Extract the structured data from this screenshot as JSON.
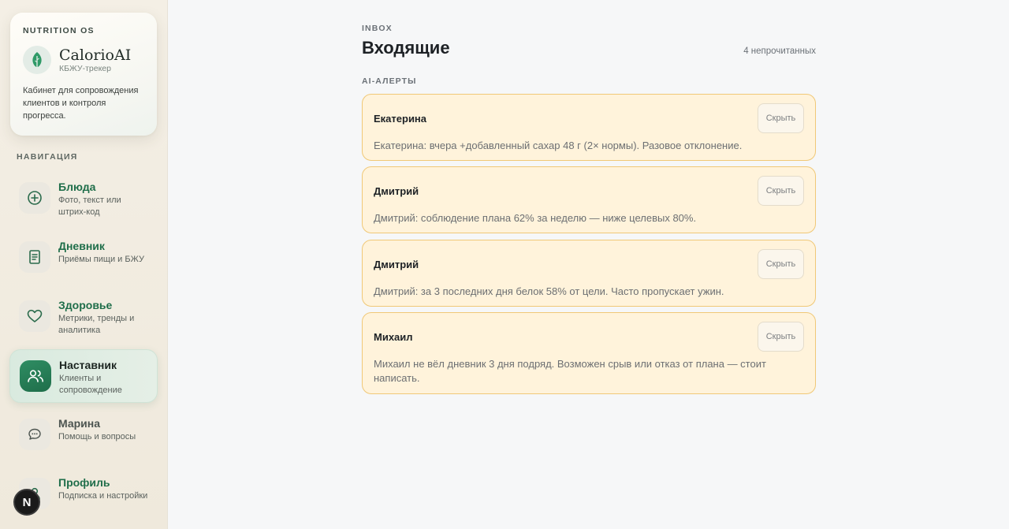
{
  "brand": {
    "kicker": "NUTRITION OS",
    "name": "CalorioAI",
    "subtitle": "КБЖУ-трекер",
    "description": "Кабинет для сопровождения клиентов и контроля прогресса."
  },
  "nav": {
    "title": "НАВИГАЦИЯ",
    "items": [
      {
        "label": "Блюда",
        "desc": "Фото, текст или штрих-код",
        "icon": "plus-circle-icon"
      },
      {
        "label": "Дневник",
        "desc": "Приёмы пищи и БЖУ",
        "icon": "journal-icon"
      },
      {
        "label": "Здоровье",
        "desc": "Метрики, тренды и аналитика",
        "icon": "heart-icon"
      },
      {
        "label": "Наставник",
        "desc": "Клиенты и сопровождение",
        "icon": "users-icon",
        "active": true
      },
      {
        "label": "Марина",
        "desc": "Помощь и вопросы",
        "icon": "chat-icon"
      },
      {
        "label": "Профиль",
        "desc": "Подписка и настройки",
        "icon": "user-icon"
      }
    ]
  },
  "badge": {
    "letter": "N"
  },
  "inbox": {
    "kicker": "INBOX",
    "title": "Входящие",
    "unread": "4 непрочитанных",
    "section": "AI-АЛЕРТЫ",
    "hide_label": "Скрыть",
    "alerts": [
      {
        "name": "Екатерина",
        "text": "Екатерина: вчера +добавленный сахар 48 г (2× нормы). Разовое отклонение."
      },
      {
        "name": "Дмитрий",
        "text": "Дмитрий: соблюдение плана 62% за неделю — ниже целевых 80%."
      },
      {
        "name": "Дмитрий",
        "text": "Дмитрий: за 3 последних дня белок 58% от цели. Часто пропускает ужин."
      },
      {
        "name": "Михаил",
        "text": "Михаил не вёл дневник 3 дня подряд. Возможен срыв или отказ от плана — стоит написать."
      }
    ]
  },
  "colors": {
    "accent": "#1f6e4a",
    "alert_bg": "#fff3db",
    "alert_border": "#f0c877"
  }
}
